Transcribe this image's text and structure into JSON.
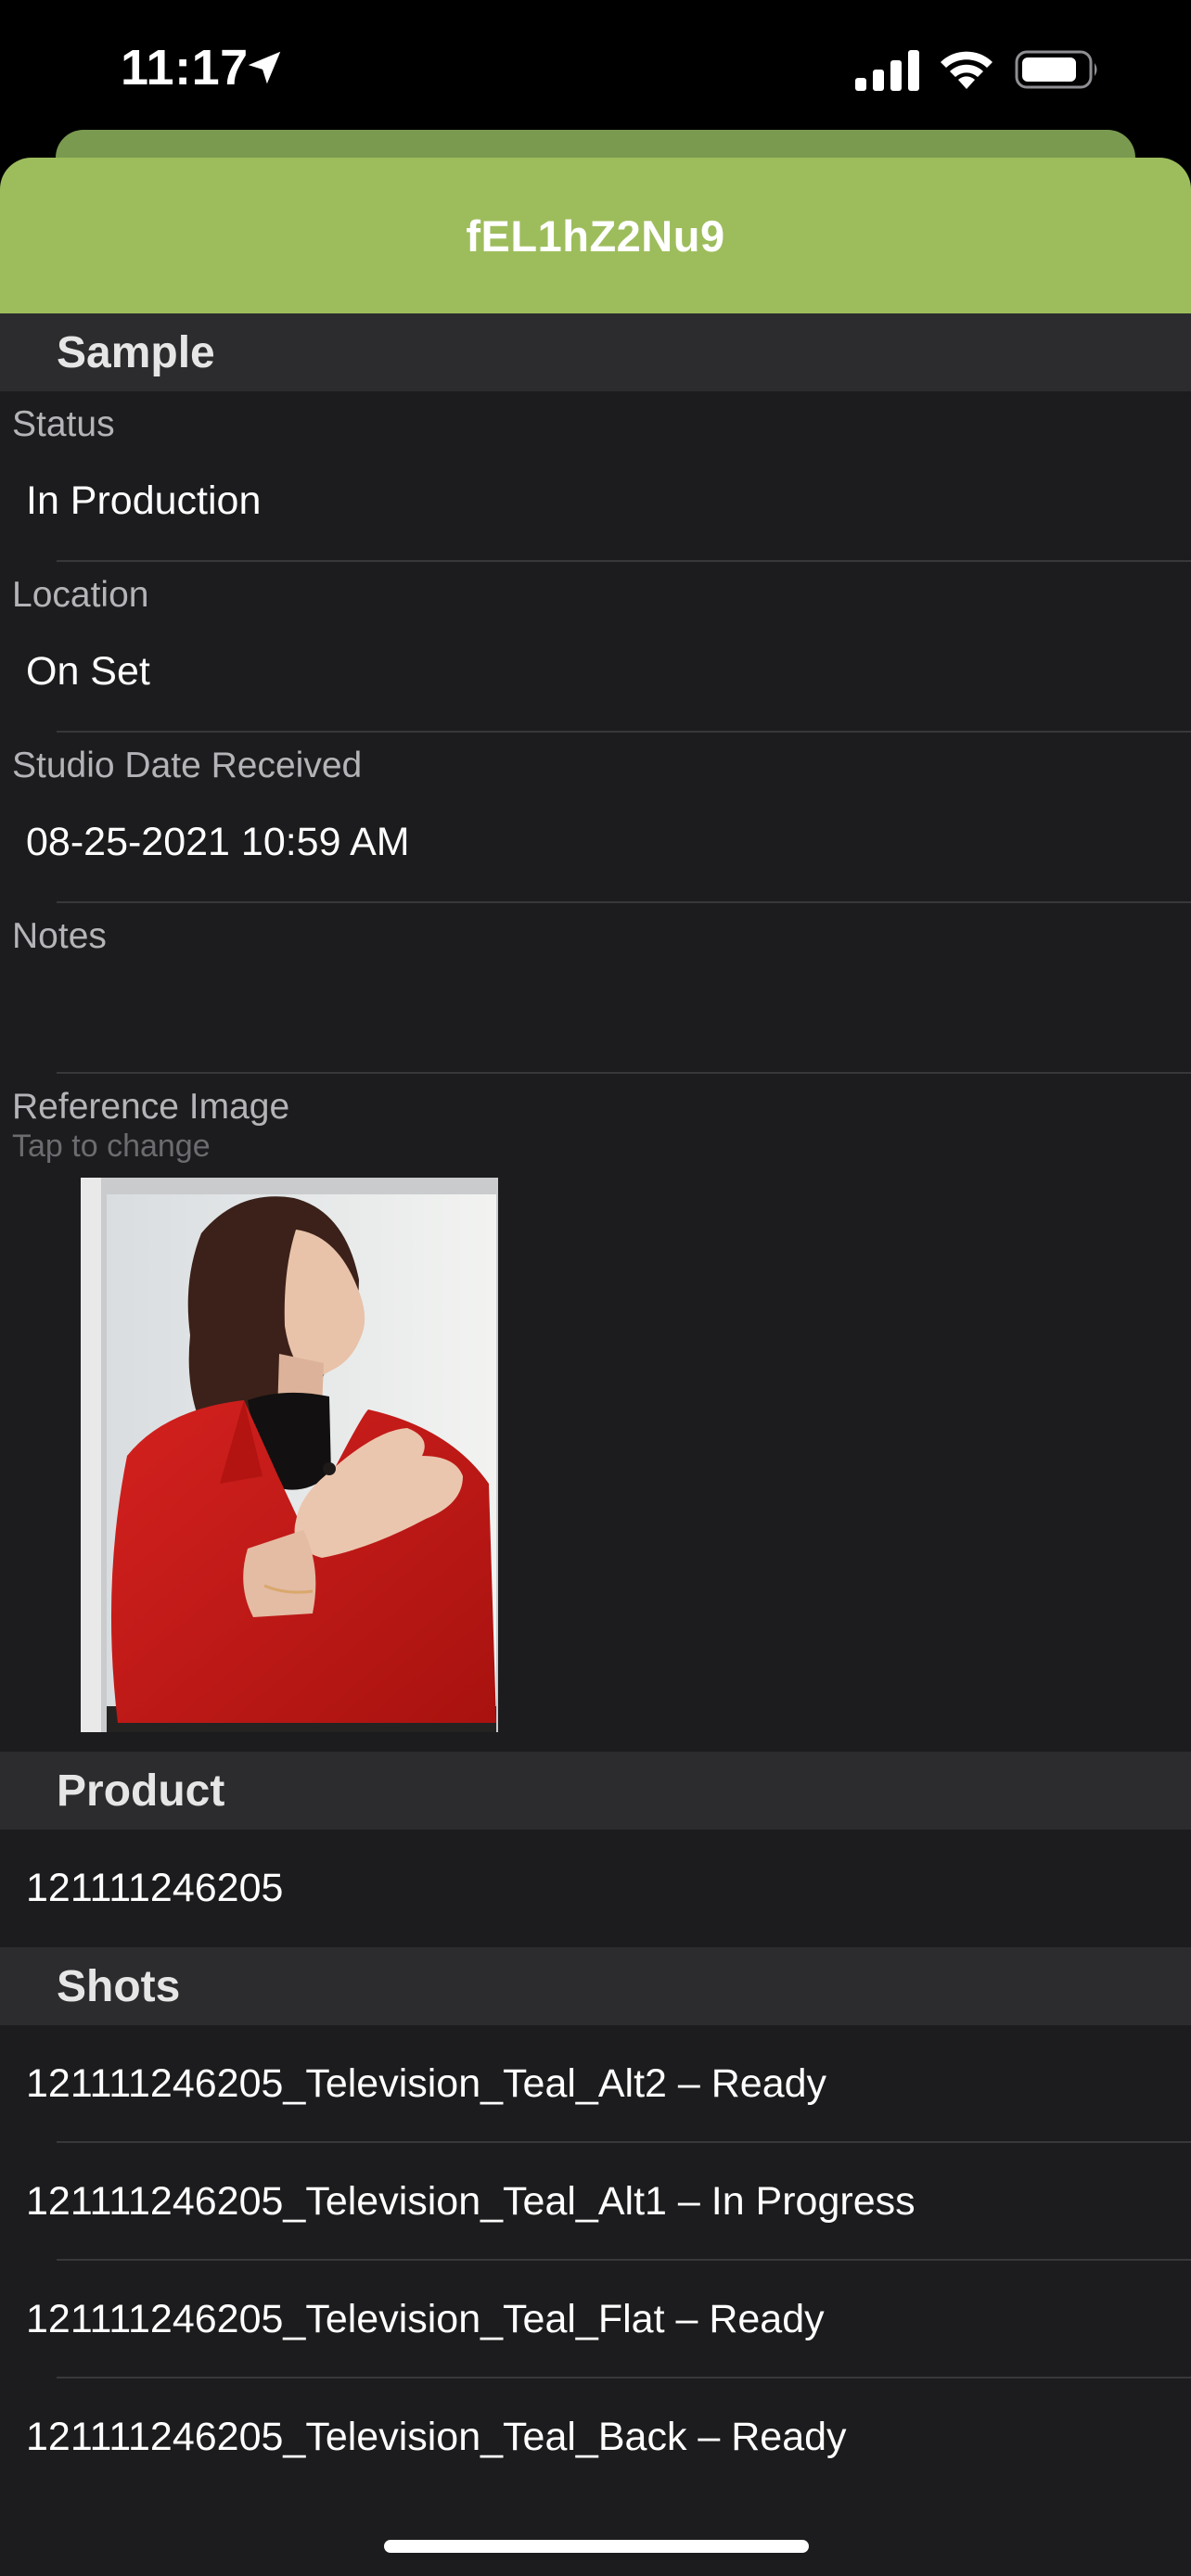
{
  "status_bar": {
    "time": "11:17",
    "icons": [
      "location-arrow-icon",
      "cellular-signal-icon",
      "wifi-icon",
      "battery-icon"
    ]
  },
  "nav": {
    "title": "fEL1hZ2Nu9",
    "accent_color": "#9dbd5c"
  },
  "sample": {
    "section_title": "Sample",
    "status_label": "Status",
    "status_value": "In Production",
    "location_label": "Location",
    "location_value": "On Set",
    "date_label": "Studio Date Received",
    "date_value": "08-25-2021 10:59 AM",
    "notes_label": "Notes",
    "notes_value": "",
    "reference_label": "Reference Image",
    "reference_hint": "Tap to change"
  },
  "product": {
    "section_title": "Product",
    "items": [
      "121111246205"
    ]
  },
  "shots": {
    "section_title": "Shots",
    "items": [
      "121111246205_Television_Teal_Alt2 – Ready",
      "121111246205_Television_Teal_Alt1 – In Progress",
      "121111246205_Television_Teal_Flat – Ready",
      "121111246205_Television_Teal_Back – Ready"
    ]
  }
}
